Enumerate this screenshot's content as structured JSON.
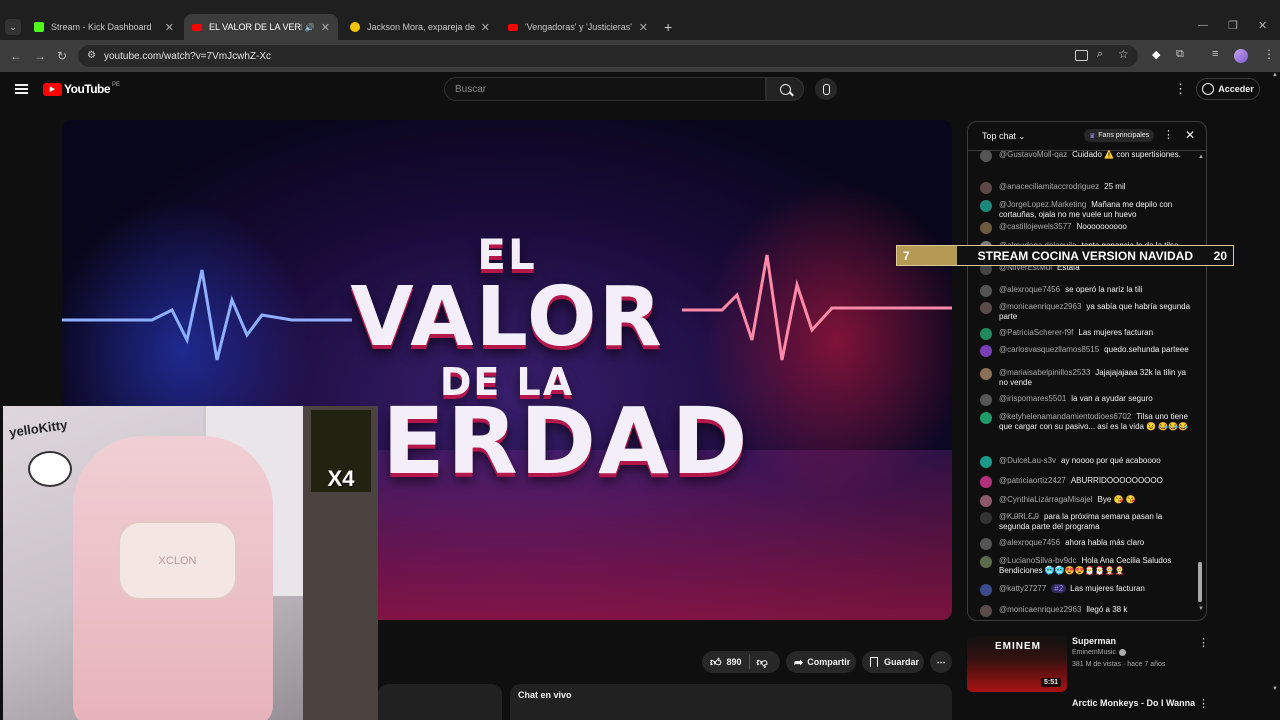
{
  "browser": {
    "tabs": [
      {
        "title": "Stream - Kick Dashboard",
        "icon": "kick-icon"
      },
      {
        "title": "EL VALOR DE LA VERDAD D",
        "icon": "youtube-icon"
      },
      {
        "title": "Jackson Mora, expareja de Tilsa",
        "icon": "news-icon"
      },
      {
        "title": "'Vengadoras' y 'Justicieras' se c",
        "icon": "youtube-icon"
      }
    ],
    "url": "youtube.com/watch?v=7VmJcwhZ-Xc"
  },
  "youtube": {
    "logo_text": "YouTube",
    "region": "PE",
    "search_placeholder": "Buscar",
    "signin_label": "Acceder"
  },
  "video": {
    "title_line1": "EL",
    "title_line2": "VALOR",
    "title_line3": "DE LA",
    "title_line4": "ERDAD",
    "webcam_sign": "yelloKitty",
    "pillow_text": "XCLON",
    "overlay_badge": "X4"
  },
  "actions": {
    "likes": "890",
    "share_label": "Compartir",
    "save_label": "Guardar",
    "chat_live_label": "Chat en vivo"
  },
  "chat": {
    "mode_label": "Top chat",
    "fans_label": "Fans principales",
    "messages": [
      {
        "author": "@GustavoMoll-qaz",
        "text": "Cuidado ⚠️ con supertisiones.",
        "color": "#555"
      },
      {
        "author": "@anaceciliamitaccrodriguez",
        "text": "25 mil",
        "color": "#5d4a44"
      },
      {
        "author": "@JorgeLopez.Marketing",
        "text": "Mañana me depilo con cortauñas, ojala no me vuele un huevo",
        "color": "#1c8a7a"
      },
      {
        "author": "@castillojewels3577",
        "text": "Noooooooooo",
        "color": "#6b5a3d"
      },
      {
        "author": "@almudena.delaguila",
        "text": "tanta ganancia le da la tilsa",
        "color": "#7a7a7a"
      },
      {
        "author": "@NilverEstMui",
        "text": "Estafa",
        "color": "#444"
      },
      {
        "author": "@alexroque7456",
        "text": "se operó la nariz la tili",
        "color": "#545454"
      },
      {
        "author": "@monicaenriquez2963",
        "text": "ya sabía que habría segunda parte",
        "color": "#5b4b4b"
      },
      {
        "author": "@PatriciaScherer-f9f",
        "text": "Las mujeres facturan",
        "color": "#1f8a5f"
      },
      {
        "author": "@carlosvasquezllamos8515",
        "text": "quedo.sehunda parteee",
        "color": "#7a3fb5"
      },
      {
        "author": "@mariaisabelpinillos2533",
        "text": "Jajajajajaaa 32k la tilin ya no vende",
        "color": "#8a7055"
      },
      {
        "author": "@irispomares5501",
        "text": "la van a ayudar seguro",
        "color": "#555"
      },
      {
        "author": "@ketyhelenamandamientodioes6702",
        "text": "Tilsa uno tiene que cargar con su pasivo... así es la vida 😉 😂😂😂",
        "color": "#1f9a6a"
      },
      {
        "author": "@DulceLau-s3v",
        "text": "ay noooo por qué acaboooo",
        "color": "#1a9a8a"
      },
      {
        "author": "@patriciaortiz2427",
        "text": "ABURRIDOOOOOOOOO",
        "color": "#b5307a"
      },
      {
        "author": "@CynthiaLizárragaMisajel",
        "text": "Bye 😘 😘",
        "color": "#8a5a6a"
      },
      {
        "author": "@ᏦᎯᏒᏞᏋᎯ",
        "text": "para la próxima semana pasan la segunda parte del programa",
        "color": "#333"
      },
      {
        "author": "@alexroque7456",
        "text": "ahora habla más claro",
        "color": "#545454"
      },
      {
        "author": "@LucianoSilva-bv9dc",
        "text": "Hola Ana Cecilia Saludos Bendiciones 🥶🥶😍😍🎅🎅🤶🤶",
        "color": "#5a6a4a"
      },
      {
        "author": "@katty27277",
        "text": "Las mujeres facturan",
        "color": "#3a4a8a",
        "badge": "#2"
      },
      {
        "author": "@monicaenriquez2963",
        "text": "llegó a 38 k",
        "color": "#5b4b4b"
      }
    ]
  },
  "banner": {
    "left_number": "7",
    "title": "STREAM COCINA VERSION NAVIDAD",
    "right_number": "20"
  },
  "suggestion": {
    "title": "Superman",
    "channel": "EminemMusic",
    "meta": "381 M de vistas · hace 7 años",
    "duration": "5:51",
    "thumb_text": "EMINEM",
    "next_title": "Arctic Monkeys - Do I Wanna"
  },
  "colors": {
    "youtube_red": "#ff0000",
    "kick_green": "#53fc18",
    "banner_gold": "#b49a55"
  }
}
